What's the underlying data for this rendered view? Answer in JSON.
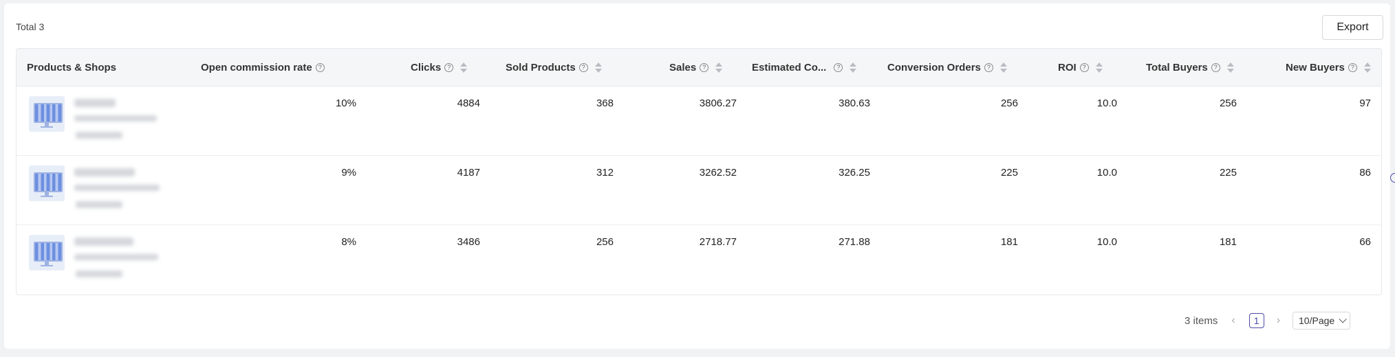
{
  "header": {
    "total_label": "Total 3",
    "export_label": "Export"
  },
  "table": {
    "columns": [
      {
        "label": "Products & Shops"
      },
      {
        "label": "Open commission rate"
      },
      {
        "label": "Clicks"
      },
      {
        "label": "Sold Products"
      },
      {
        "label": "Sales"
      },
      {
        "label": "Estimated Co..."
      },
      {
        "label": "Conversion Orders"
      },
      {
        "label": "ROI"
      },
      {
        "label": "Total Buyers"
      },
      {
        "label": "New Buyers"
      }
    ],
    "rows": [
      {
        "commission": "10%",
        "clicks": "4884",
        "sold": "368",
        "sales": "3806.27",
        "est_commission": "380.63",
        "orders": "256",
        "roi": "10.0",
        "total_buyers": "256",
        "new_buyers": "97"
      },
      {
        "commission": "9%",
        "clicks": "4187",
        "sold": "312",
        "sales": "3262.52",
        "est_commission": "326.25",
        "orders": "225",
        "roi": "10.0",
        "total_buyers": "225",
        "new_buyers": "86"
      },
      {
        "commission": "8%",
        "clicks": "3486",
        "sold": "256",
        "sales": "2718.77",
        "est_commission": "271.88",
        "orders": "181",
        "roi": "10.0",
        "total_buyers": "181",
        "new_buyers": "66"
      }
    ]
  },
  "pagination": {
    "items_label": "3 items",
    "current_page": "1",
    "page_size": "10/Page",
    "prev_icon": "chevron-left-icon",
    "next_icon": "chevron-right-icon"
  },
  "icons": {
    "help": "?",
    "help_icon": "help-circle-icon",
    "sort_icon": "sort-icon"
  },
  "colors": {
    "accent": "#4a4aa8",
    "background": "#f1f2f4",
    "header_bg": "#f5f6f7"
  }
}
